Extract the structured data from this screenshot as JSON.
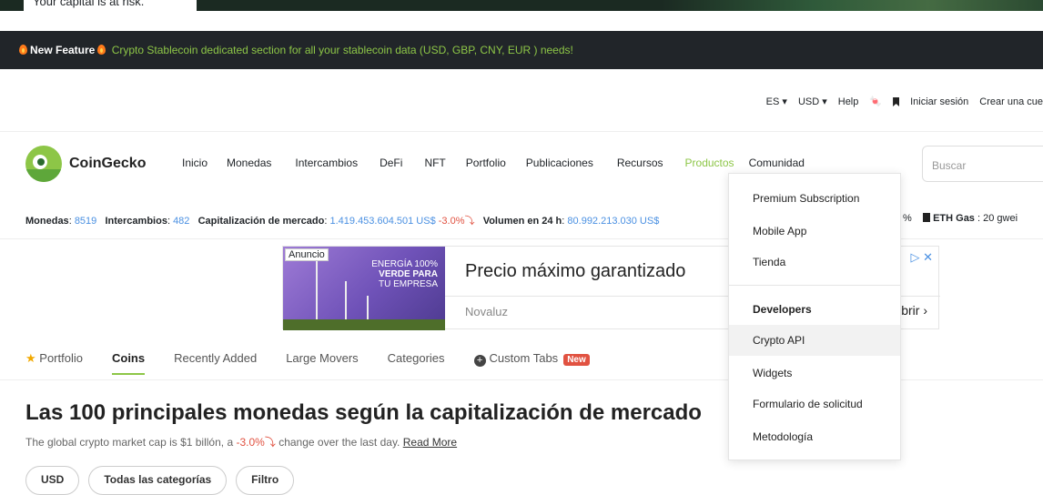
{
  "risk": {
    "text": "Your capital is at risk."
  },
  "banner": {
    "new_feature": "New Feature",
    "message": "Crypto Stablecoin dedicated section for all your stablecoin data (USD, GBP, CNY, EUR ) needs!"
  },
  "util": {
    "lang": "ES ▾",
    "currency": "USD ▾",
    "help": "Help",
    "login": "Iniciar sesión",
    "signup": "Crear una cue"
  },
  "header": {
    "brand": "CoinGecko",
    "search_placeholder": "Buscar"
  },
  "nav": [
    "Inicio",
    "Monedas",
    "Intercambios",
    "DeFi",
    "NFT",
    "Portfolio",
    "Publicaciones",
    "Recursos",
    "Productos",
    "Comunidad"
  ],
  "stats": {
    "coins_label": "Monedas",
    "coins_value": "8519",
    "exchanges_label": "Intercambios",
    "exchanges_value": "482",
    "mcap_label": "Capitalización de mercado",
    "mcap_value": "1.419.453.604.501 US$",
    "mcap_change": "-3.0%",
    "vol_label": "Volumen en 24 h",
    "vol_value": "80.992.213.030 US$",
    "pct_tail": "%",
    "gas_label": "ETH Gas",
    "gas_value": "20 gwei"
  },
  "ad": {
    "badge": "Anuncio",
    "slogan_line1": "ENERGÍA 100%",
    "slogan_line2": "VERDE PARA",
    "slogan_line3": "TU EMPRESA",
    "title": "Precio máximo garantizado",
    "advertiser": "Novaluz",
    "open": "Abrir"
  },
  "tabs": [
    "Portfolio",
    "Coins",
    "Recently Added",
    "Large Movers",
    "Categories",
    "Custom Tabs"
  ],
  "tabs_new_badge": "New",
  "page": {
    "title": "Las 100 principales monedas según la capitalización de mercado",
    "subtitle_pre": "The global crypto market cap is $1 billón, a",
    "subtitle_change": "-3.0%",
    "subtitle_post": "change over the last day.",
    "read_more": "Read More"
  },
  "filters": [
    "USD",
    "Todas las categorías",
    "Filtro"
  ],
  "dropdown": {
    "items": [
      "Premium Subscription",
      "Mobile App",
      "Tienda"
    ],
    "dev_header": "Developers",
    "dev_items": [
      "Crypto API",
      "Widgets",
      "Formulario de solicitud",
      "Metodología"
    ]
  },
  "colors": {
    "brand_green": "#8dc647",
    "link_blue": "#4a90e2",
    "negative_red": "#e15241"
  }
}
